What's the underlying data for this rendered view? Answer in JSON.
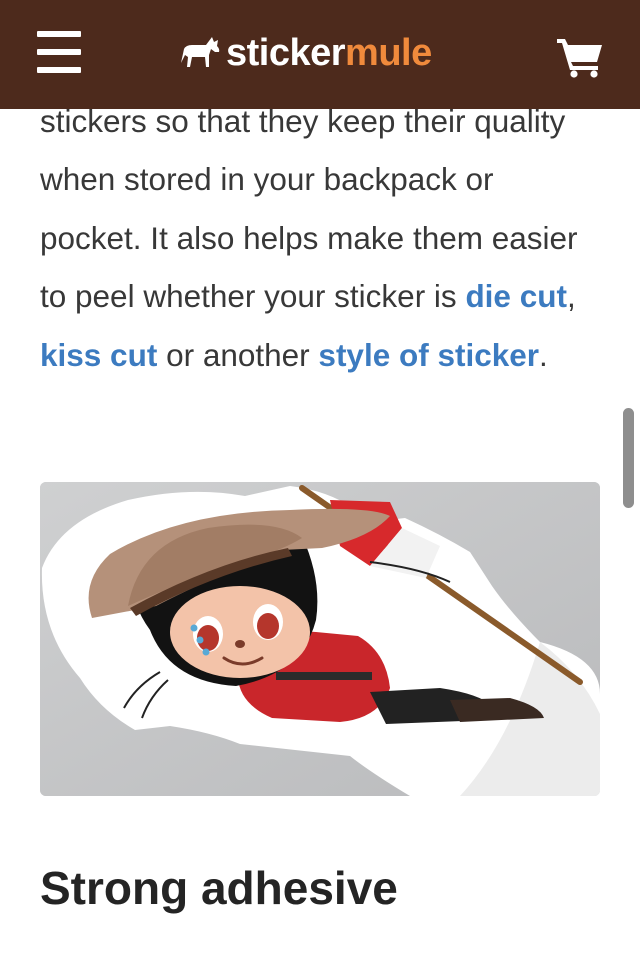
{
  "header": {
    "menu_icon": "hamburger-menu-icon",
    "logo": {
      "part1": "sticker",
      "part2": "mule",
      "icon": "mule-logo-icon"
    },
    "cart_icon": "shopping-cart-icon",
    "background": "#4d2a1c"
  },
  "article": {
    "paragraph": {
      "text1": "stickers so that they keep their quality when stored in your backpack or pocket. It also helps make them easier to peel whether your sticker is ",
      "link1": "die cut",
      "text2": ", ",
      "link2": "kiss cut",
      "text3": " or another ",
      "link3": "style of sticker",
      "text4": "."
    },
    "image_alt": "Die cut sticker of a cartoon octocat wearing a Mountie hat and red uniform holding a flag",
    "heading": "Strong adhesive",
    "link_color": "#3c7bc0"
  }
}
